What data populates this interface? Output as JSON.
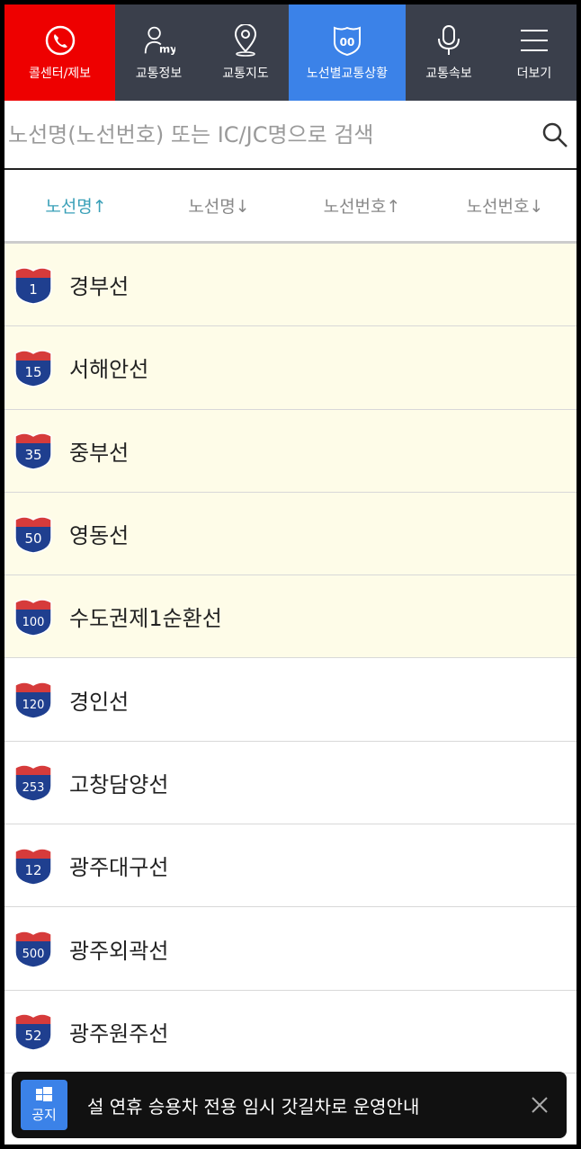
{
  "nav": {
    "items": [
      {
        "label": "콜센터/제보",
        "icon": "phone-icon"
      },
      {
        "label": "교통정보",
        "icon": "user-my-icon"
      },
      {
        "label": "교통지도",
        "icon": "map-pin-icon"
      },
      {
        "label": "노선별교통상황",
        "icon": "route-shield-icon"
      },
      {
        "label": "교통속보",
        "icon": "microphone-icon"
      },
      {
        "label": "더보기",
        "icon": "menu-icon"
      }
    ],
    "my_text": "my",
    "shield_text": "00"
  },
  "search": {
    "placeholder": "노선명(노선번호) 또는 IC/JC명으로 검색"
  },
  "sort": {
    "tabs": [
      {
        "label": "노선명↑",
        "active": true
      },
      {
        "label": "노선명↓",
        "active": false
      },
      {
        "label": "노선번호↑",
        "active": false
      },
      {
        "label": "노선번호↓",
        "active": false
      }
    ]
  },
  "routes": [
    {
      "number": "1",
      "name": "경부선"
    },
    {
      "number": "15",
      "name": "서해안선"
    },
    {
      "number": "35",
      "name": "중부선"
    },
    {
      "number": "50",
      "name": "영동선"
    },
    {
      "number": "100",
      "name": "수도권제1순환선"
    },
    {
      "number": "120",
      "name": "경인선"
    },
    {
      "number": "253",
      "name": "고창담양선"
    },
    {
      "number": "12",
      "name": "광주대구선"
    },
    {
      "number": "500",
      "name": "광주외곽선"
    },
    {
      "number": "52",
      "name": "광주원주선"
    }
  ],
  "notice": {
    "badge": "공지",
    "text": "설 연휴 승용차 전용 임시 갓길차로 운영안내"
  },
  "colors": {
    "nav_bg": "#3a3f4b",
    "callcenter_bg": "#ee0000",
    "active_nav_bg": "#3b82e8",
    "active_sort": "#3aa0b8",
    "highlight_row": "#fefce8"
  }
}
